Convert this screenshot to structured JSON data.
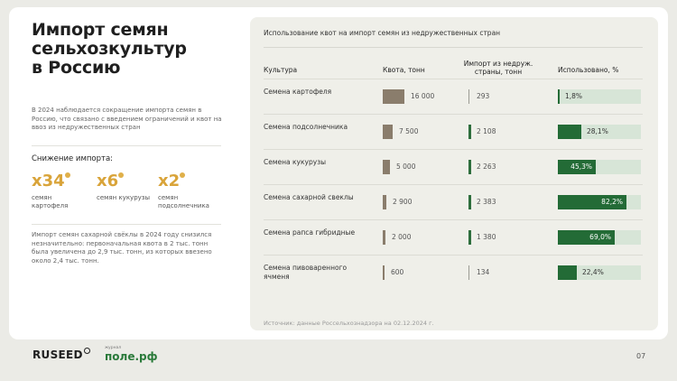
{
  "left": {
    "title": "Импорт семян\nсельхозкультур\nв Россию",
    "intro": "В 2024 наблюдается сокращение импорта семян в Россию, что связано с введением ограничений и квот на ввоз из недружественных стран",
    "reduction_heading": "Снижение импорта:",
    "multipliers": [
      {
        "value": "x34",
        "label": "семян картофеля"
      },
      {
        "value": "x6",
        "label": "семян кукурузы"
      },
      {
        "value": "x2",
        "label": "семян подсолнечника"
      }
    ],
    "beet_note": "Импорт семян сахарной свёклы в 2024 году снизился незначительно: первоначальная квота в 2 тыс. тонн была увеличена до 2,9 тыс. тонн, из которых ввезено около 2,4 тыс. тонн."
  },
  "panel": {
    "title": "Использование квот на импорт семян из недружественных стран",
    "source": "Источник: данные Россельхознадзора на 02.12.2024 г."
  },
  "chart_data": {
    "type": "table",
    "columns": [
      "Культура",
      "Квота, тонн",
      "Импорт из недруж. страны, тонн",
      "Использовано, %"
    ],
    "rows": [
      {
        "crop": "Семена картофеля",
        "quota": 16000,
        "quota_label": "16 000",
        "import": 293,
        "import_label": "293",
        "used": 1.8,
        "used_label": "1,8%"
      },
      {
        "crop": "Семена подсолнечника",
        "quota": 7500,
        "quota_label": "7 500",
        "import": 2108,
        "import_label": "2 108",
        "used": 28.1,
        "used_label": "28,1%"
      },
      {
        "crop": "Семена кукурузы",
        "quota": 5000,
        "quota_label": "5 000",
        "import": 2263,
        "import_label": "2 263",
        "used": 45.3,
        "used_label": "45,3%"
      },
      {
        "crop": "Семена сахарной свеклы",
        "quota": 2900,
        "quota_label": "2 900",
        "import": 2383,
        "import_label": "2 383",
        "used": 82.2,
        "used_label": "82,2%"
      },
      {
        "crop": "Семена рапса гибридные",
        "quota": 2000,
        "quota_label": "2 000",
        "import": 1380,
        "import_label": "1 380",
        "used": 69.0,
        "used_label": "69,0%"
      },
      {
        "crop": "Семена пивоваренного ячменя",
        "quota": 600,
        "quota_label": "600",
        "import": 134,
        "import_label": "134",
        "used": 22.4,
        "used_label": "22,4%"
      }
    ],
    "colors": {
      "quota": "#8a7d6c",
      "import": "#2e6e3d",
      "used": "#236b36",
      "used_bg": "#d7e5d7"
    }
  },
  "footer": {
    "brand": "RUSEED",
    "journal_label": "журнал",
    "journal_name": "поле.рф",
    "page": "07"
  }
}
